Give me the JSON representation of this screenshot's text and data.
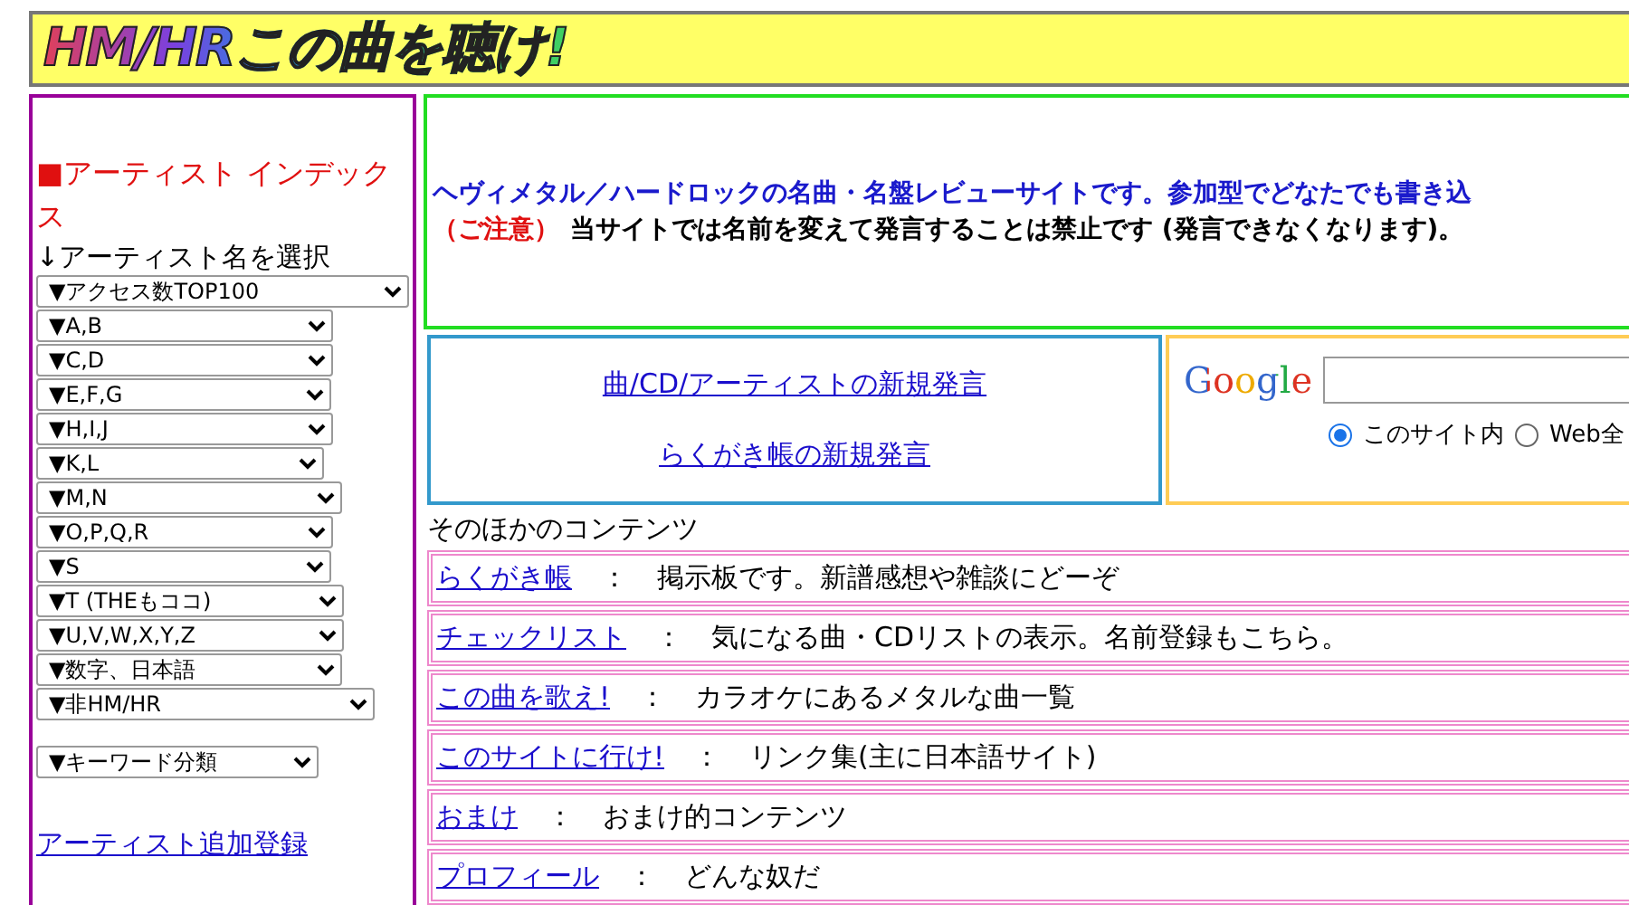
{
  "header": {
    "title": "HM/HRこの曲を聴け!"
  },
  "sidebar": {
    "heading_mark": "■",
    "heading": "アーティスト インデックス",
    "prompt": "↓アーティスト名を選択",
    "selects": [
      "▼アクセス数TOP100",
      "▼A,B",
      "▼C,D",
      "▼E,F,G",
      "▼H,I,J",
      "▼K,L",
      "▼M,N",
      "▼O,P,Q,R",
      "▼S",
      "▼T (THEもココ)",
      "▼U,V,W,X,Y,Z",
      "▼数字、日本語",
      "▼非HM/HR"
    ],
    "keyword_select": "▼キーワード分類",
    "link": "アーティスト追加登録"
  },
  "intro": {
    "lead": "ヘヴィメタル／ハードロックの名曲・名盤レビューサイトです。参加型でどなたでも書き込",
    "notice_label": "（ご注意）",
    "notice": "当サイトでは名前を変えて発言することは禁止です (発言できなくなります)。"
  },
  "post_links": [
    "曲/CD/アーティストの新規発言",
    "らくがき帳の新規発言"
  ],
  "search": {
    "logo": "Google",
    "scopes": [
      {
        "label": "このサイト内",
        "selected": true
      },
      {
        "label": "Web全",
        "selected": false
      }
    ]
  },
  "contents": {
    "heading": "そのほかのコンテンツ",
    "separator": "：",
    "items": [
      {
        "link": "らくがき帳",
        "description": "掲示板です。新譜感想や雑談にどーぞ"
      },
      {
        "link": "チェックリスト",
        "description": "気になる曲・CDリストの表示。名前登録もこちら。"
      },
      {
        "link": "この曲を歌え!",
        "description": "カラオケにあるメタルな曲一覧"
      },
      {
        "link": "このサイトに行け!",
        "description": "リンク集(主に日本語サイト)"
      },
      {
        "link": "おまけ",
        "description": "おまけ的コンテンツ"
      },
      {
        "link": "プロフィール",
        "description": "どんな奴だ"
      }
    ]
  }
}
